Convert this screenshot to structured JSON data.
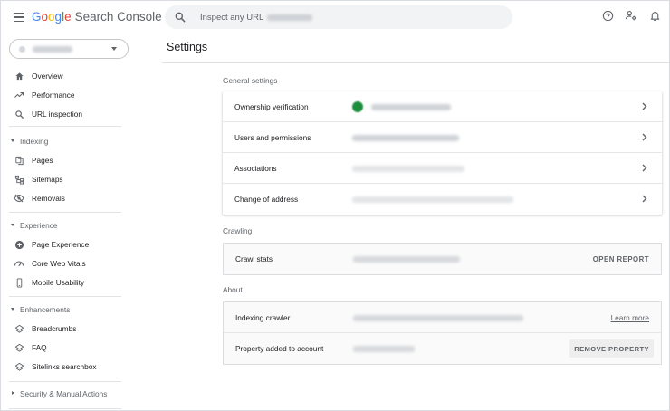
{
  "app": {
    "logo_letters": [
      {
        "ch": "G",
        "color": "#4285F4"
      },
      {
        "ch": "o",
        "color": "#EA4335"
      },
      {
        "ch": "o",
        "color": "#FBBC05"
      },
      {
        "ch": "g",
        "color": "#4285F4"
      },
      {
        "ch": "l",
        "color": "#34A853"
      },
      {
        "ch": "e",
        "color": "#EA4335"
      }
    ],
    "product_name": "Search Console"
  },
  "search": {
    "placeholder": "Inspect any URL in"
  },
  "sidebar": {
    "primary": [
      {
        "label": "Overview",
        "icon": "home-icon"
      },
      {
        "label": "Performance",
        "icon": "trending-icon"
      },
      {
        "label": "URL inspection",
        "icon": "search-icon"
      }
    ],
    "sections": [
      {
        "title": "Indexing",
        "expanded": true,
        "items": [
          {
            "label": "Pages",
            "icon": "pages-icon"
          },
          {
            "label": "Sitemaps",
            "icon": "sitemap-icon"
          },
          {
            "label": "Removals",
            "icon": "removals-icon"
          }
        ]
      },
      {
        "title": "Experience",
        "expanded": true,
        "items": [
          {
            "label": "Page Experience",
            "icon": "plus-circle-icon"
          },
          {
            "label": "Core Web Vitals",
            "icon": "gauge-icon"
          },
          {
            "label": "Mobile Usability",
            "icon": "phone-icon"
          }
        ]
      },
      {
        "title": "Enhancements",
        "expanded": true,
        "items": [
          {
            "label": "Breadcrumbs",
            "icon": "layers-icon"
          },
          {
            "label": "FAQ",
            "icon": "layers-icon"
          },
          {
            "label": "Sitelinks searchbox",
            "icon": "layers-icon"
          }
        ]
      },
      {
        "title": "Security & Manual Actions",
        "expanded": false,
        "items": []
      }
    ]
  },
  "main": {
    "title": "Settings",
    "general": {
      "label": "General settings",
      "rows": [
        {
          "label": "Ownership verification"
        },
        {
          "label": "Users and permissions"
        },
        {
          "label": "Associations"
        },
        {
          "label": "Change of address"
        }
      ]
    },
    "crawling": {
      "label": "Crawling",
      "row": {
        "label": "Crawl stats",
        "action": "OPEN REPORT"
      }
    },
    "about": {
      "label": "About",
      "rows": [
        {
          "label": "Indexing crawler",
          "action": "Learn more"
        },
        {
          "label": "Property added to account",
          "action": "REMOVE PROPERTY"
        }
      ]
    }
  },
  "colors": {
    "accent_green": "#1e8e3e",
    "text_primary": "#202124",
    "text_secondary": "#5f6368"
  }
}
